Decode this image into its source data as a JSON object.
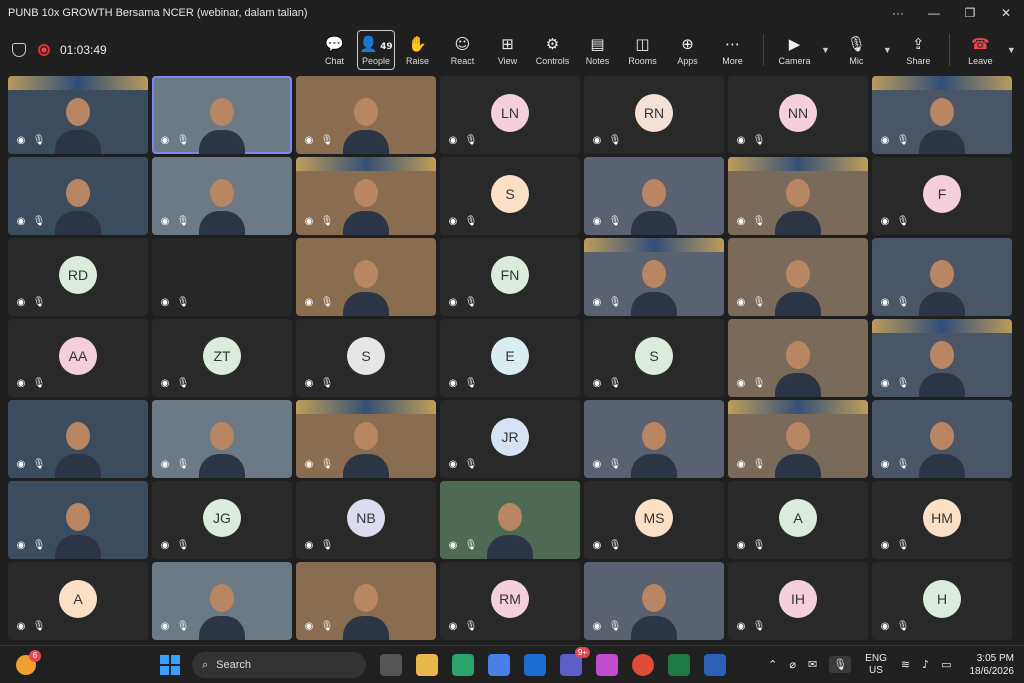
{
  "window": {
    "title": "PUNB 10x GROWTH Bersama NCER (webinar, dalam talian)",
    "controls": [
      "···",
      "—",
      "❐",
      "✕"
    ]
  },
  "toolbar": {
    "timer": "01:03:49",
    "chat": "Chat",
    "people": "People",
    "people_count": "49",
    "raise": "Raise",
    "react": "React",
    "view": "View",
    "controls": "Controls",
    "notes": "Notes",
    "rooms": "Rooms",
    "apps": "Apps",
    "more": "More",
    "camera": "Camera",
    "mic": "Mic",
    "share": "Share",
    "leave": "Leave"
  },
  "tiles": [
    {
      "type": "video",
      "initials": ""
    },
    {
      "type": "video",
      "initials": "",
      "selected": true
    },
    {
      "type": "video",
      "initials": ""
    },
    {
      "type": "avatar",
      "initials": "LN",
      "color": "#f5d0da"
    },
    {
      "type": "avatar",
      "initials": "RN",
      "color": "#f5e0d6"
    },
    {
      "type": "avatar",
      "initials": "NN",
      "color": "#f5d0da"
    },
    {
      "type": "video",
      "initials": ""
    },
    {
      "type": "video",
      "initials": ""
    },
    {
      "type": "video",
      "initials": ""
    },
    {
      "type": "video",
      "initials": ""
    },
    {
      "type": "avatar",
      "initials": "S",
      "color": "#fbe0c6"
    },
    {
      "type": "video",
      "initials": ""
    },
    {
      "type": "video",
      "initials": ""
    },
    {
      "type": "avatar",
      "initials": "F",
      "color": "#f5d0da"
    },
    {
      "type": "avatar",
      "initials": "RD",
      "color": "#dcecdc"
    },
    {
      "type": "blank",
      "initials": ""
    },
    {
      "type": "video",
      "initials": ""
    },
    {
      "type": "avatar",
      "initials": "FN",
      "color": "#dcecdc"
    },
    {
      "type": "video",
      "initials": ""
    },
    {
      "type": "video",
      "initials": ""
    },
    {
      "type": "video",
      "initials": ""
    },
    {
      "type": "avatar",
      "initials": "AA",
      "color": "#f5d0da"
    },
    {
      "type": "avatar",
      "initials": "ZT",
      "color": "#dcecdc"
    },
    {
      "type": "avatar",
      "initials": "S",
      "color": "#e6e6e6"
    },
    {
      "type": "avatar",
      "initials": "E",
      "color": "#d9eef0"
    },
    {
      "type": "avatar",
      "initials": "S",
      "color": "#dcecdc"
    },
    {
      "type": "video",
      "initials": ""
    },
    {
      "type": "video",
      "initials": ""
    },
    {
      "type": "video",
      "initials": ""
    },
    {
      "type": "video",
      "initials": ""
    },
    {
      "type": "video",
      "initials": ""
    },
    {
      "type": "avatar",
      "initials": "JR",
      "color": "#d6e2f5"
    },
    {
      "type": "video",
      "initials": ""
    },
    {
      "type": "video",
      "initials": ""
    },
    {
      "type": "video",
      "initials": ""
    },
    {
      "type": "video",
      "initials": ""
    },
    {
      "type": "avatar",
      "initials": "JG",
      "color": "#dcecdc"
    },
    {
      "type": "avatar",
      "initials": "NB",
      "color": "#dcdcf0"
    },
    {
      "type": "video",
      "initials": ""
    },
    {
      "type": "avatar",
      "initials": "MS",
      "color": "#fbe0c6"
    },
    {
      "type": "avatar",
      "initials": "A",
      "color": "#dcecdc"
    },
    {
      "type": "avatar",
      "initials": "HM",
      "color": "#fbe0c6"
    },
    {
      "type": "avatar",
      "initials": "A",
      "color": "#fbe0c6"
    },
    {
      "type": "video",
      "initials": ""
    },
    {
      "type": "video",
      "initials": ""
    },
    {
      "type": "avatar",
      "initials": "RM",
      "color": "#f5d0da"
    },
    {
      "type": "video",
      "initials": ""
    },
    {
      "type": "avatar",
      "initials": "IH",
      "color": "#f5d0da"
    },
    {
      "type": "avatar",
      "initials": "H",
      "color": "#dcecdc"
    }
  ],
  "taskbar": {
    "weather_badge": "6",
    "search": "Search",
    "teams_badge": "9+",
    "lang1": "ENG",
    "lang2": "US",
    "time": "3:05 PM",
    "date": "18/6/2026"
  }
}
